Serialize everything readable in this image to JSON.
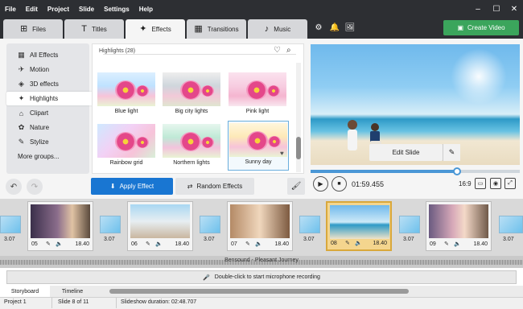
{
  "menu": [
    "File",
    "Edit",
    "Project",
    "Slide",
    "Settings",
    "Help"
  ],
  "window_controls": {
    "minimize": "–",
    "maximize": "☐",
    "close": "✕"
  },
  "tabs": [
    {
      "label": "Files",
      "icon": "⊞"
    },
    {
      "label": "Titles",
      "icon": "T"
    },
    {
      "label": "Effects",
      "icon": "✦"
    },
    {
      "label": "Transitions",
      "icon": "▦"
    },
    {
      "label": "Music",
      "icon": "♪"
    }
  ],
  "toolbar_icons": [
    "⚙",
    "🔔",
    "🖼"
  ],
  "create_video": {
    "label": "Create Video",
    "icon": "▣"
  },
  "sidebar": [
    {
      "label": "All Effects",
      "icon": "▦"
    },
    {
      "label": "Motion",
      "icon": "✈"
    },
    {
      "label": "3D effects",
      "icon": "◈"
    },
    {
      "label": "Highlights",
      "icon": "✦"
    },
    {
      "label": "Clipart",
      "icon": "⌂"
    },
    {
      "label": "Nature",
      "icon": "✿"
    },
    {
      "label": "Stylize",
      "icon": "✎"
    },
    {
      "label": "More groups...",
      "icon": ""
    }
  ],
  "gallery": {
    "header": "Highlights (28)",
    "items": [
      {
        "label": "Blue light"
      },
      {
        "label": "Big city lights"
      },
      {
        "label": "Pink light"
      },
      {
        "label": "Rainbow grid"
      },
      {
        "label": "Northern lights"
      },
      {
        "label": "Sunny day"
      }
    ]
  },
  "undo_icon": "↶",
  "redo_icon": "↷",
  "apply_effect": {
    "label": "Apply Effect",
    "icon": "⬇"
  },
  "random_effects": {
    "label": "Random Effects",
    "icon": "⇄"
  },
  "brush_icon": "🖌",
  "preview": {
    "edit_slide": "Edit Slide",
    "edit_icon": "✎",
    "progress": 0.7,
    "play_icon": "▶",
    "stop_icon": "■",
    "timecode": "01:59.455",
    "ratio": "16:9"
  },
  "timeline": {
    "slides": [
      {
        "num": "05",
        "dur": "18.40"
      },
      {
        "num": "06",
        "dur": "18.40"
      },
      {
        "num": "07",
        "dur": "18.40"
      },
      {
        "num": "08",
        "dur": "18.40"
      },
      {
        "num": "09",
        "dur": "18.40"
      }
    ],
    "transition_durations": [
      "3.07",
      "3.07",
      "3.07",
      "3.07",
      "3.07",
      "3.07"
    ]
  },
  "audio": {
    "track": "Bensound - Pleasant Journey"
  },
  "mic": {
    "label": "Double-click to start microphone recording",
    "icon": "🎤"
  },
  "bottom_tabs": [
    "Storyboard",
    "Timeline"
  ],
  "status": {
    "project": "Project 1",
    "slide": "Slide 8 of 11",
    "duration": "Slideshow duration: 02:48.707"
  },
  "colors": {
    "accent": "#1976d2",
    "create": "#3ba55c",
    "dark": "#2d2f33",
    "selected": "#f4d58e"
  }
}
